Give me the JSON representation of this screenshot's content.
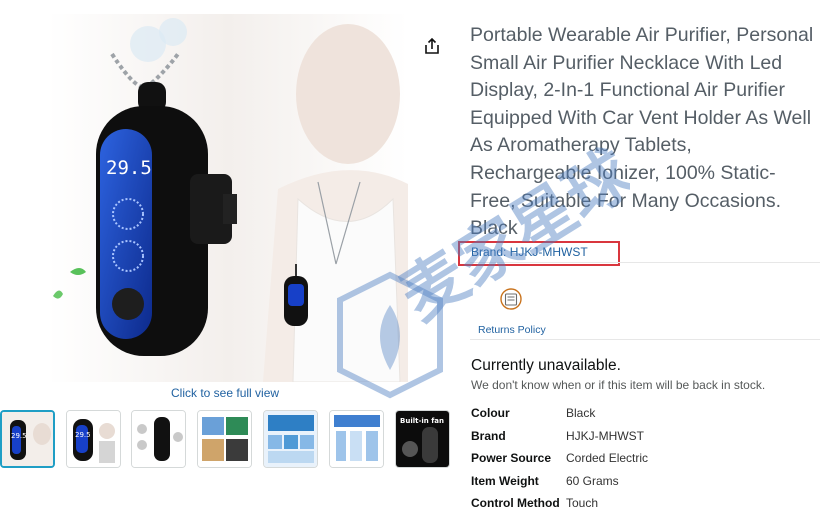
{
  "product": {
    "title": "Portable Wearable Air Purifier, Personal Small Air Purifier Necklace With Led Display, 2-In-1 Functional Air Purifier Equipped With Car Vent Holder As Well As Aromatherapy Tablets, Rechargeable Ionizer, 100% Static-Free, Suitable For Many Occasions. Black",
    "brand_link": "Brand: HJKJ-MHWST",
    "device_display": "29.5"
  },
  "gallery": {
    "full_view_link": "Click to see full view",
    "thumbnails": [
      {
        "label": "29.5"
      },
      {
        "label": "29.5"
      },
      {
        "label": ""
      },
      {
        "label": ""
      },
      {
        "label": ""
      },
      {
        "label": ""
      },
      {
        "label": "Built-in fan"
      }
    ]
  },
  "returns": {
    "label": "Returns Policy"
  },
  "availability": {
    "status": "Currently unavailable.",
    "note": "We don't know when or if this item will be back in stock."
  },
  "specs": [
    {
      "key": "Colour",
      "value": "Black"
    },
    {
      "key": "Brand",
      "value": "HJKJ-MHWST"
    },
    {
      "key": "Power Source",
      "value": "Corded Electric"
    },
    {
      "key": "Item Weight",
      "value": "60 Grams"
    },
    {
      "key": "Control Method",
      "value": "Touch"
    }
  ],
  "watermark": {
    "text": "麦家星球"
  },
  "colors": {
    "link": "#2162a1",
    "title": "#555e66",
    "highlight_box": "#d9363e",
    "thumb_selected": "#1f9ec5",
    "device_screen": "#1740c8"
  }
}
